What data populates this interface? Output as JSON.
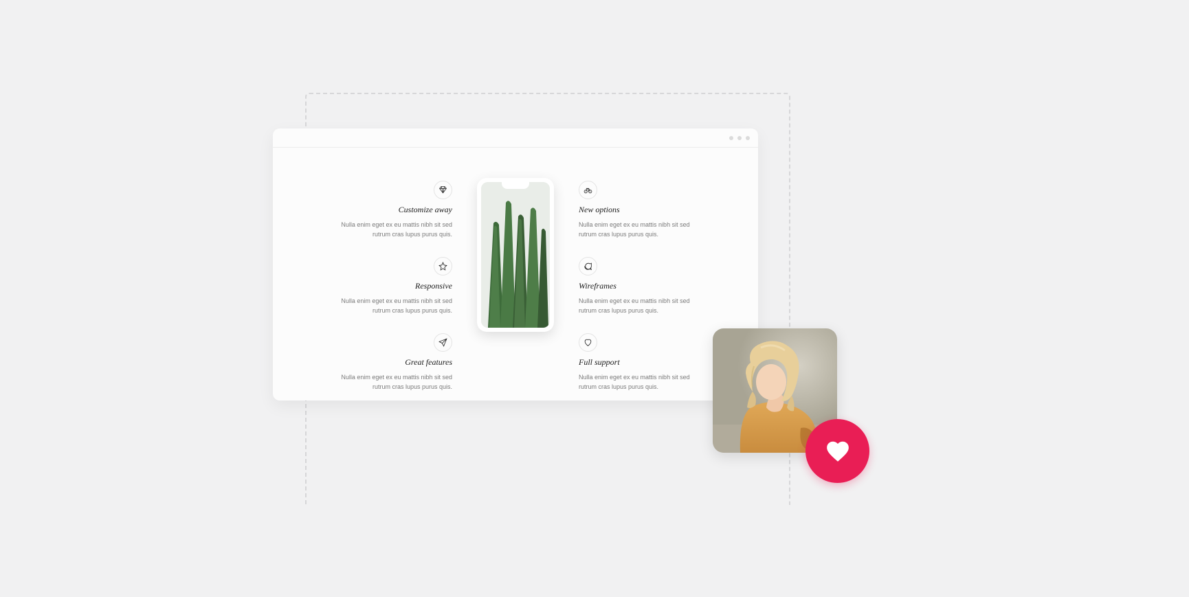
{
  "features": {
    "left": [
      {
        "icon": "diamond",
        "title": "Customize away",
        "desc": "Nulla enim eget ex eu mattis nibh sit sed rutrum cras lupus purus quis."
      },
      {
        "icon": "star",
        "title": "Responsive",
        "desc": "Nulla enim eget ex eu mattis nibh sit sed rutrum cras lupus purus quis."
      },
      {
        "icon": "paper-plane",
        "title": "Great features",
        "desc": "Nulla enim eget ex eu mattis nibh sit sed rutrum cras lupus purus quis."
      }
    ],
    "right": [
      {
        "icon": "bicycle",
        "title": "New options",
        "desc": "Nulla enim eget ex eu mattis nibh sit sed rutrum cras lupus purus quis."
      },
      {
        "icon": "chat",
        "title": "Wireframes",
        "desc": "Nulla enim eget ex eu mattis nibh sit sed rutrum cras lupus purus quis."
      },
      {
        "icon": "heart",
        "title": "Full support",
        "desc": "Nulla enim eget ex eu mattis nibh sit sed rutrum cras lupus purus quis."
      }
    ]
  },
  "colors": {
    "accent": "#e91e55"
  }
}
